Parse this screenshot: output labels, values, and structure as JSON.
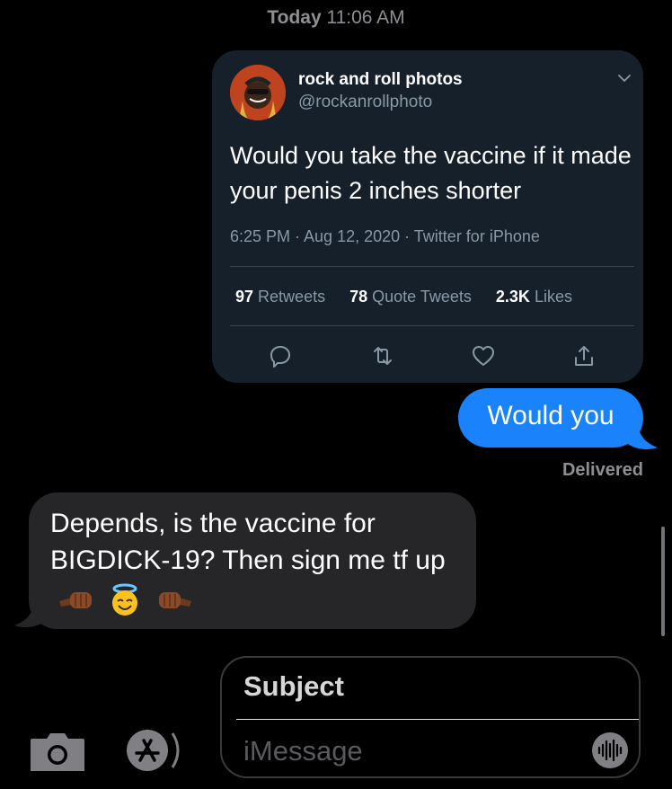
{
  "header": {
    "day": "Today",
    "time": "11:06 AM"
  },
  "tweet": {
    "author_name": "rock and roll photos",
    "author_handle": "@rockanrollphoto",
    "text": "Would you take the vaccine if it made your penis 2 inches shorter",
    "meta": "6:25 PM · Aug 12, 2020 · Twitter for iPhone",
    "stats": [
      {
        "count": "97",
        "label": "Retweets"
      },
      {
        "count": "78",
        "label": "Quote Tweets"
      },
      {
        "count": "2.3K",
        "label": "Likes"
      }
    ],
    "icons": [
      "reply-icon",
      "retweet-icon",
      "like-icon",
      "share-icon"
    ]
  },
  "messages": {
    "outgoing_text": "Would you",
    "status": "Delivered",
    "incoming_text": "Depends, is the vaccine for BIGDICK-19? Then sign me tf up",
    "incoming_emojis": [
      "fist-bump-right-emoji",
      "smiling-halo-emoji",
      "fist-bump-left-emoji"
    ]
  },
  "compose": {
    "subject_placeholder": "Subject",
    "message_placeholder": "iMessage"
  },
  "colors": {
    "background": "#000000",
    "outgoing_bubble": "#1a82fb",
    "incoming_bubble": "#262628",
    "tweet_card": "#15202b",
    "secondary_text": "#8e8e93",
    "twitter_secondary": "#8899a6"
  }
}
